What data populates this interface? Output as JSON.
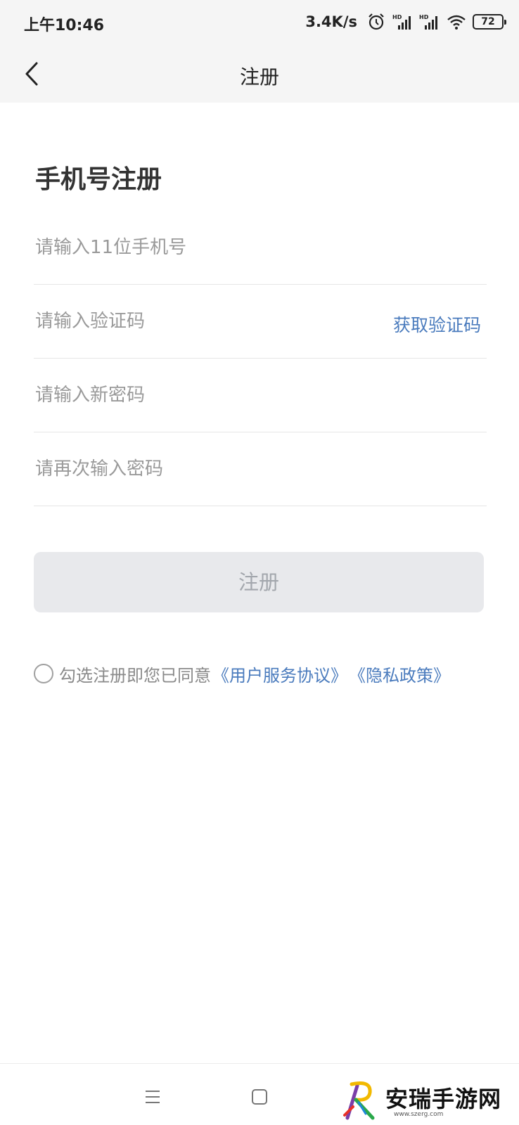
{
  "status_bar": {
    "time": "上午10:46",
    "net_speed": "3.4K/s",
    "battery": "72",
    "icons": [
      "alarm-icon",
      "hd-signal-icon",
      "hd-signal-icon",
      "wifi-icon",
      "battery-icon"
    ]
  },
  "nav": {
    "title": "注册",
    "back_icon": "chevron-left-icon"
  },
  "form": {
    "heading": "手机号注册",
    "phone_placeholder": "请输入11位手机号",
    "code_placeholder": "请输入验证码",
    "get_code_label": "获取验证码",
    "password_placeholder": "请输入新密码",
    "confirm_placeholder": "请再次输入密码",
    "submit_label": "注册"
  },
  "agreement": {
    "text": "勾选注册即您已同意",
    "terms_link": "《用户服务协议》",
    "privacy_link": "《隐私政策》"
  },
  "system_nav": {
    "icons": [
      "menu-icon",
      "home-icon"
    ]
  },
  "watermark": {
    "site_name": "安瑞手游网",
    "url": "www.szerg.com"
  },
  "colors": {
    "link": "#4a7bbd",
    "button_bg": "#e8e9ec",
    "button_text": "#a3a7ad",
    "header_bg": "#f5f5f5"
  }
}
